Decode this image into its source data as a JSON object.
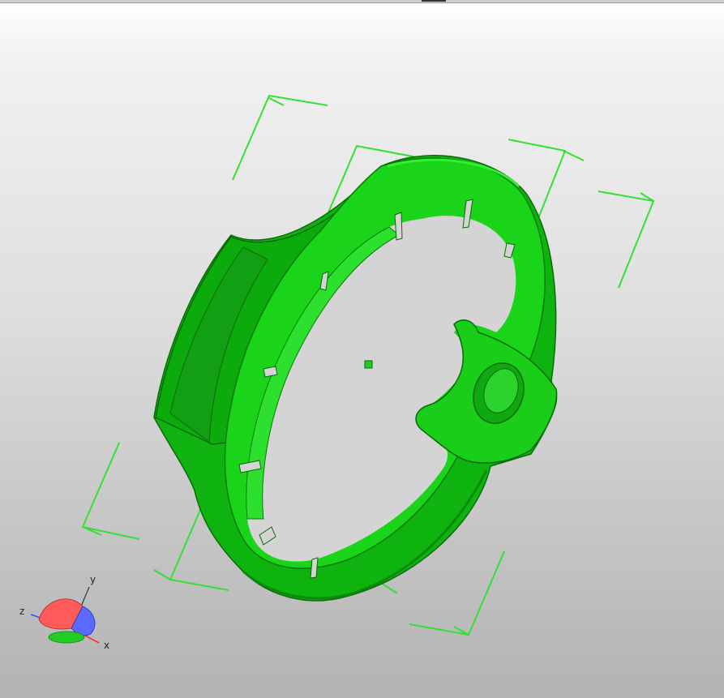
{
  "viewer": {
    "model_color": "#17d817",
    "bbox_color": "#33e033",
    "background_top": "#ffffff",
    "background_bottom": "#b3b3b3"
  },
  "axes_gizmo": {
    "x_label": "x",
    "y_label": "y",
    "z_label": "z",
    "x_color": "#ff2020",
    "y_color": "#33aa33",
    "z_color": "#3050ff"
  }
}
